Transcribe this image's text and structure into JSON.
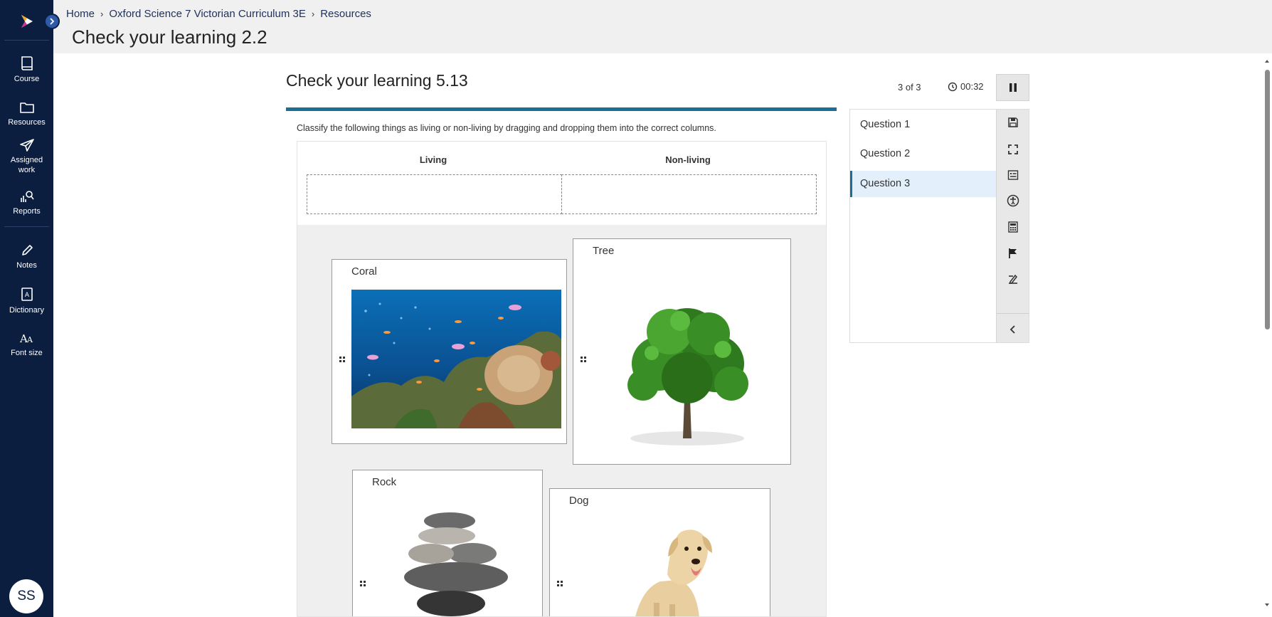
{
  "sidebar": {
    "items": [
      {
        "label": "Course",
        "icon": "book-icon"
      },
      {
        "label": "Resources",
        "icon": "folder-icon"
      },
      {
        "label": "Assigned\nwork",
        "icon": "paper-plane-icon"
      },
      {
        "label": "Reports",
        "icon": "reports-icon"
      },
      {
        "label": "Notes",
        "icon": "pencil-icon"
      },
      {
        "label": "Dictionary",
        "icon": "dictionary-icon"
      },
      {
        "label": "Font size",
        "icon": "font-size-icon"
      }
    ],
    "avatar_initials": "SS"
  },
  "header": {
    "breadcrumb": [
      "Home",
      "Oxford Science 7 Victorian Curriculum 3E",
      "Resources"
    ],
    "title": "Check your learning 2.2"
  },
  "assessment": {
    "title": "Check your learning 5.13",
    "counter": "3 of 3",
    "timer": "00:32",
    "instructions": "Classify the following things as living or non-living by dragging and dropping them into the correct columns.",
    "columns": {
      "living": "Living",
      "non_living": "Non-living"
    },
    "cards": {
      "coral": "Coral",
      "tree": "Tree",
      "rock": "Rock",
      "dog": "Dog"
    }
  },
  "questions": [
    {
      "label": "Question 1"
    },
    {
      "label": "Question 2"
    },
    {
      "label": "Question 3",
      "active": true
    }
  ],
  "colors": {
    "sidebar_bg": "#0b1e3f",
    "accent": "#1b6f95",
    "active_question_bg": "#e3f0fb"
  }
}
